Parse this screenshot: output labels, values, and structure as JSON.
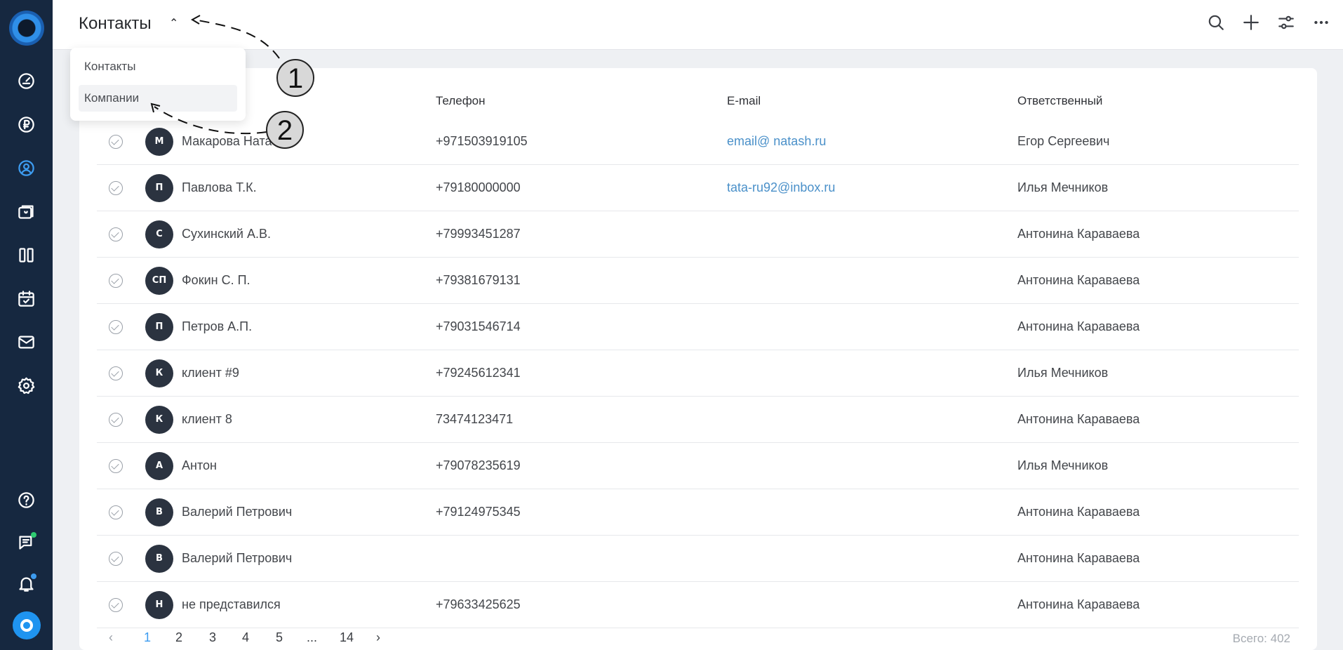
{
  "sidebar": {
    "logo_icon": "app-logo-icon",
    "items": [
      {
        "icon": "dashboard-icon"
      },
      {
        "icon": "ruble-icon"
      },
      {
        "icon": "contacts-icon",
        "active": true
      },
      {
        "icon": "deals-icon"
      },
      {
        "icon": "board-icon"
      },
      {
        "icon": "calendar-check-icon"
      },
      {
        "icon": "mail-icon"
      },
      {
        "icon": "settings-icon"
      }
    ],
    "bottom_items": [
      {
        "icon": "help-icon"
      },
      {
        "icon": "chat-icon",
        "badge_color": "#2ecc71"
      },
      {
        "icon": "bell-icon",
        "badge_color": "#3d9cf0"
      },
      {
        "icon": "support-logo-icon"
      }
    ],
    "accent_color": "#3d9cf0",
    "bg_color": "#162840"
  },
  "header": {
    "title": "Контакты",
    "chevron_icon": "chevron-up-icon",
    "actions": [
      {
        "icon": "search-icon"
      },
      {
        "icon": "plus-icon"
      },
      {
        "icon": "filter-sliders-icon"
      },
      {
        "icon": "more-dots-icon"
      }
    ]
  },
  "dropdown": {
    "items": [
      {
        "label": "Контакты"
      },
      {
        "label": "Компании"
      }
    ]
  },
  "table": {
    "columns": [
      "Телефон",
      "E-mail",
      "Ответственный"
    ],
    "rows": [
      {
        "initials": "М",
        "name": "Макарова Ната",
        "phone": "+971503919105",
        "email": "email@ natash.ru",
        "responsible": "Егор Сергеевич"
      },
      {
        "initials": "П",
        "name": "Павлова Т.К.",
        "phone": "+79180000000",
        "email": "tata-ru92@inbox.ru",
        "responsible": "Илья Мечников"
      },
      {
        "initials": "С",
        "name": "Сухинский А.В.",
        "phone": "+79993451287",
        "email": "",
        "responsible": "Антонина Караваева"
      },
      {
        "initials": "СП",
        "name": "Фокин С. П.",
        "phone": "+79381679131",
        "email": "",
        "responsible": "Антонина Караваева"
      },
      {
        "initials": "П",
        "name": "Петров А.П.",
        "phone": "+79031546714",
        "email": "",
        "responsible": "Антонина Караваева"
      },
      {
        "initials": "К",
        "name": "клиент #9",
        "phone": "+79245612341",
        "email": "",
        "responsible": "Илья Мечников"
      },
      {
        "initials": "К",
        "name": "клиент 8",
        "phone": "73474123471",
        "email": "",
        "responsible": "Антонина Караваева"
      },
      {
        "initials": "А",
        "name": "Антон",
        "phone": "+79078235619",
        "email": "",
        "responsible": "Илья Мечников"
      },
      {
        "initials": "В",
        "name": "Валерий Петрович",
        "phone": "+79124975345",
        "email": "",
        "responsible": "Антонина Караваева"
      },
      {
        "initials": "В",
        "name": "Валерий Петрович",
        "phone": "",
        "email": "",
        "responsible": "Антонина Караваева"
      },
      {
        "initials": "Н",
        "name": "не представился",
        "phone": "+79633425625",
        "email": "",
        "responsible": "Антонина Караваева"
      }
    ]
  },
  "pagination": {
    "prev": "‹",
    "pages": [
      "1",
      "2",
      "3",
      "4",
      "5",
      "...",
      "14"
    ],
    "current": "1",
    "next": "›",
    "total": "Всего: 402"
  },
  "annotations": {
    "markers": [
      {
        "label": "1"
      },
      {
        "label": "2"
      }
    ]
  }
}
